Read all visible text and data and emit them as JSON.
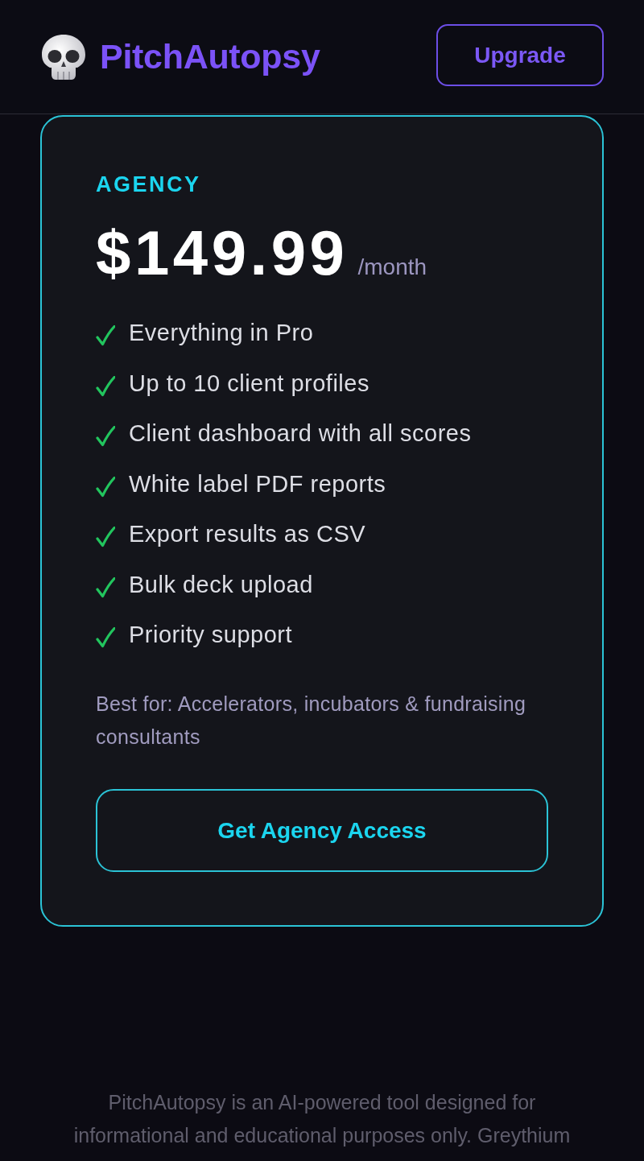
{
  "header": {
    "brand": "PitchAutopsy",
    "upgrade_button": "Upgrade"
  },
  "plan": {
    "name": "AGENCY",
    "price": "$149.99",
    "period": "/month",
    "features": [
      "Everything in Pro",
      "Up to 10 client profiles",
      "Client dashboard with all scores",
      "White label PDF reports",
      "Export results as CSV",
      "Bulk deck upload",
      "Priority support"
    ],
    "best_for": "Best for: Accelerators, incubators & fundraising consultants",
    "button": "Get Agency Access"
  },
  "footer": {
    "disclaimer": "PitchAutopsy is an AI-powered tool designed for informational and educational purposes only. Greythium"
  }
}
